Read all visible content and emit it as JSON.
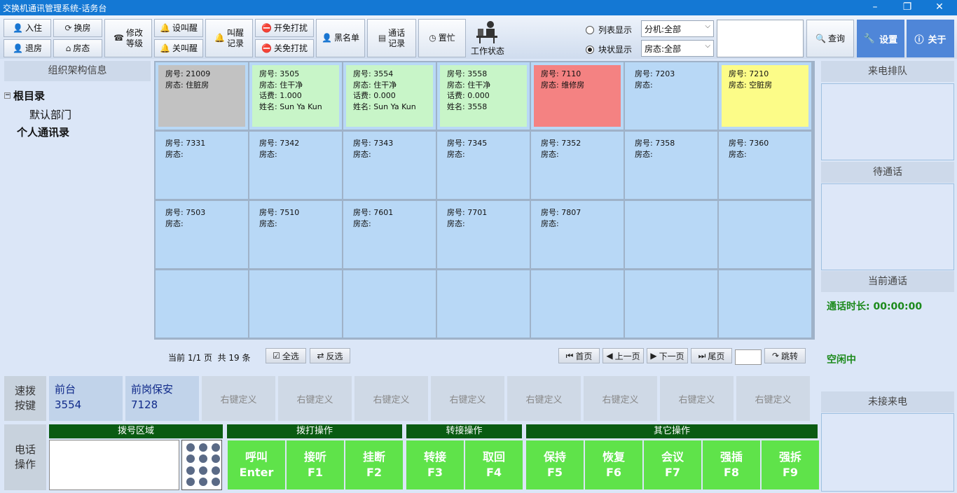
{
  "window": {
    "title": "交换机通讯管理系统-话务台",
    "min": "–",
    "max": "❐",
    "close": "✕"
  },
  "toolbar": {
    "checkin": "入住",
    "checkout": "退房",
    "change_room": "换房",
    "room_status": "房态",
    "modify_level": [
      "修改",
      "等级"
    ],
    "set_wakeup": "设叫醒",
    "cancel_wakeup": "关叫醒",
    "wakeup_record": [
      "叫醒",
      "记录"
    ],
    "dnd_on": "开免打扰",
    "dnd_off": "关免打扰",
    "blacklist": "黑名单",
    "call_record": [
      "通话",
      "记录"
    ],
    "busy": "置忙",
    "work_status": "工作状态",
    "list_view": "列表显示",
    "block_view": "块状显示",
    "ext_filter": "分机:全部",
    "status_filter": "房态:全部",
    "search_value": "",
    "query": "查询",
    "settings": "设置",
    "about": "关于"
  },
  "left": {
    "header": "组织架构信息",
    "root": "根目录",
    "dept": "默认部门",
    "personal": "个人通讯录"
  },
  "labels": {
    "room": "房号:",
    "status": "房态:",
    "fee": "话费:",
    "name": "姓名:"
  },
  "rooms": [
    {
      "room": "21009",
      "status": "住脏房",
      "color": "gray"
    },
    {
      "room": "3505",
      "status": "住干净",
      "fee": "1.000",
      "name": "Sun Ya Kun",
      "color": "green"
    },
    {
      "room": "3554",
      "status": "住干净",
      "fee": "0.000",
      "name": "Sun Ya Kun",
      "color": "green"
    },
    {
      "room": "3558",
      "status": "住干净",
      "fee": "0.000",
      "name": "3558",
      "color": "green"
    },
    {
      "room": "7110",
      "status": "维修房",
      "color": "red"
    },
    {
      "room": "7203",
      "status": "",
      "color": "blue"
    },
    {
      "room": "7210",
      "status": "空脏房",
      "color": "yellow"
    },
    {
      "room": "7331",
      "status": "",
      "color": "blue"
    },
    {
      "room": "7342",
      "status": "",
      "color": "blue"
    },
    {
      "room": "7343",
      "status": "",
      "color": "blue"
    },
    {
      "room": "7345",
      "status": "",
      "color": "blue"
    },
    {
      "room": "7352",
      "status": "",
      "color": "blue"
    },
    {
      "room": "7358",
      "status": "",
      "color": "blue"
    },
    {
      "room": "7360",
      "status": "",
      "color": "blue"
    },
    {
      "room": "7503",
      "status": "",
      "color": "blue"
    },
    {
      "room": "7510",
      "status": "",
      "color": "blue"
    },
    {
      "room": "7601",
      "status": "",
      "color": "blue"
    },
    {
      "room": "7701",
      "status": "",
      "color": "blue"
    },
    {
      "room": "7807",
      "status": "",
      "color": "blue"
    }
  ],
  "grid_colors": {
    "gray": "#c2c2c2",
    "green": "#c8f5c8",
    "red": "#f48282",
    "yellow": "#fcfc88",
    "blue": "#b8d8f6"
  },
  "pager": {
    "info": "当前 1/1 页  共 19 条",
    "select_all": "全选",
    "invert": "反选",
    "first": "首页",
    "prev": "上一页",
    "next": "下一页",
    "last": "尾页",
    "page_value": "",
    "jump": "跳转"
  },
  "speed_dial": {
    "label": [
      "速拨",
      "按键"
    ],
    "fixed": [
      {
        "name": "前台",
        "num": "3554"
      },
      {
        "name": "前岗保安",
        "num": "7128"
      }
    ],
    "custom": [
      "右键定义",
      "右键定义",
      "右键定义",
      "右键定义",
      "右键定义",
      "右键定义",
      "右键定义",
      "右键定义"
    ]
  },
  "phone": {
    "label": [
      "电话",
      "操作"
    ],
    "dial_area": "拨号区域",
    "dial_ops": "拨打操作",
    "transfer_ops": "转接操作",
    "other_ops": "其它操作",
    "call": [
      "呼叫",
      "Enter"
    ],
    "answer": [
      "接听",
      "F1"
    ],
    "hangup": [
      "挂断",
      "F2"
    ],
    "transfer": [
      "转接",
      "F3"
    ],
    "retrieve": [
      "取回",
      "F4"
    ],
    "hold": [
      "保持",
      "F5"
    ],
    "resume": [
      "恢复",
      "F6"
    ],
    "conference": [
      "会议",
      "F7"
    ],
    "barge": [
      "强插",
      "F8"
    ],
    "split": [
      "强拆",
      "F9"
    ]
  },
  "right": {
    "queue": "来电排队",
    "waiting": "待通话",
    "current": "当前通话",
    "duration": "通话时长: 00:00:00",
    "idle": "空闲中",
    "missed": "未接来电"
  }
}
